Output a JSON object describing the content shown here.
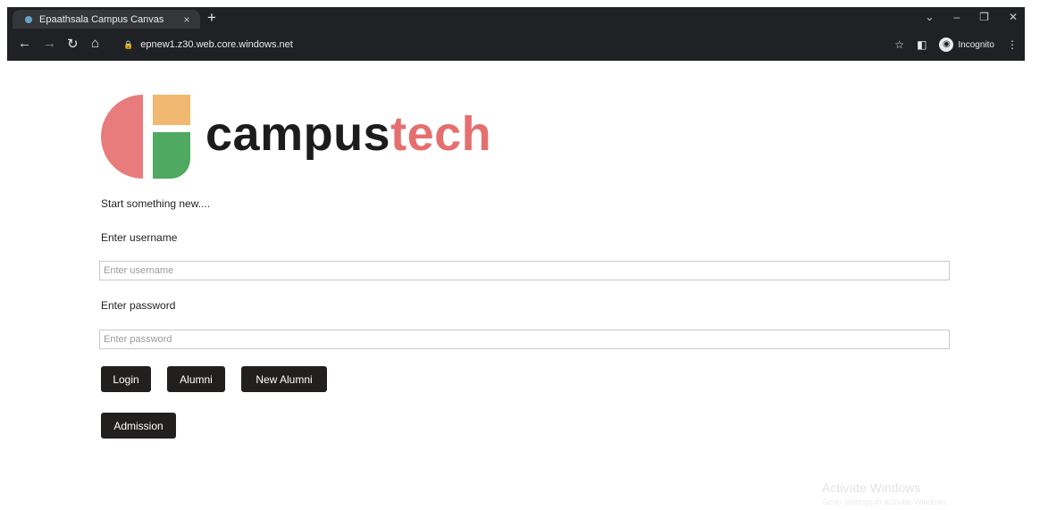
{
  "browser": {
    "tab_title": "Epaathsala Campus Canvas",
    "tab_close": "×",
    "new_tab": "+",
    "url": "epnew1.z30.web.core.windows.net",
    "incognito_label": "Incognito",
    "icons": [
      "back-icon",
      "forward-icon",
      "reload-icon",
      "home-icon",
      "lock-icon",
      "star-icon",
      "side-panel-icon",
      "incognito-icon",
      "menu-icon"
    ]
  },
  "logo": {
    "word1": "campus",
    "word2": "tech",
    "colors": {
      "red": "#e87b7c",
      "orange": "#f0b871",
      "green": "#4fa960",
      "dark": "#1c1c1c",
      "accent": "#e56f6e"
    }
  },
  "form": {
    "tagline": "Start something new....",
    "username_label": "Enter username",
    "username_placeholder": "Enter username",
    "username_value": "",
    "password_label": "Enter password",
    "password_placeholder": "Enter password",
    "password_value": ""
  },
  "buttons": {
    "login": "Login",
    "alumni": "Alumni",
    "new_alumni": "New Alumni",
    "admission": "Admission"
  },
  "watermark": {
    "title": "Activate Windows",
    "subtitle": "Go to Settings to activate Windows."
  }
}
